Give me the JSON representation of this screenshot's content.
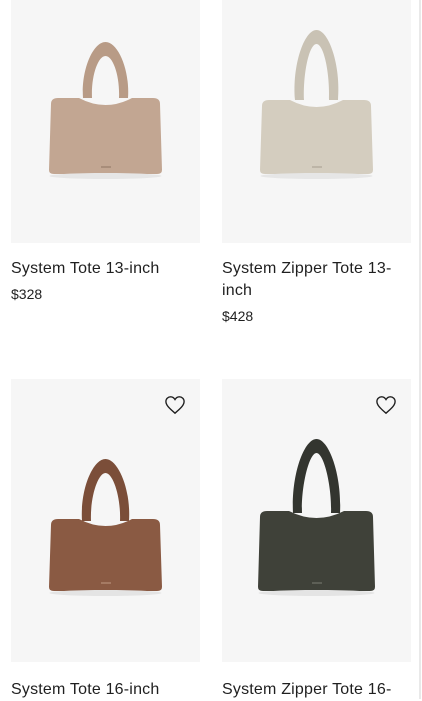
{
  "products": [
    {
      "title": "System Tote 13-inch",
      "price": "$328",
      "color": "#c2a692",
      "icon": "tote-bag-image"
    },
    {
      "title": "System Zipper Tote 13-inch",
      "price": "$428",
      "color": "#d4cdbf",
      "icon": "tote-bag-image"
    },
    {
      "title": "System Tote 16-inch",
      "price": "",
      "color": "#8a5a43",
      "icon": "tote-bag-image",
      "favorite_icon": "heart-icon"
    },
    {
      "title": "System Zipper Tote 16-",
      "price": "",
      "color": "#3f4139",
      "icon": "tote-bag-image",
      "favorite_icon": "heart-icon"
    }
  ]
}
